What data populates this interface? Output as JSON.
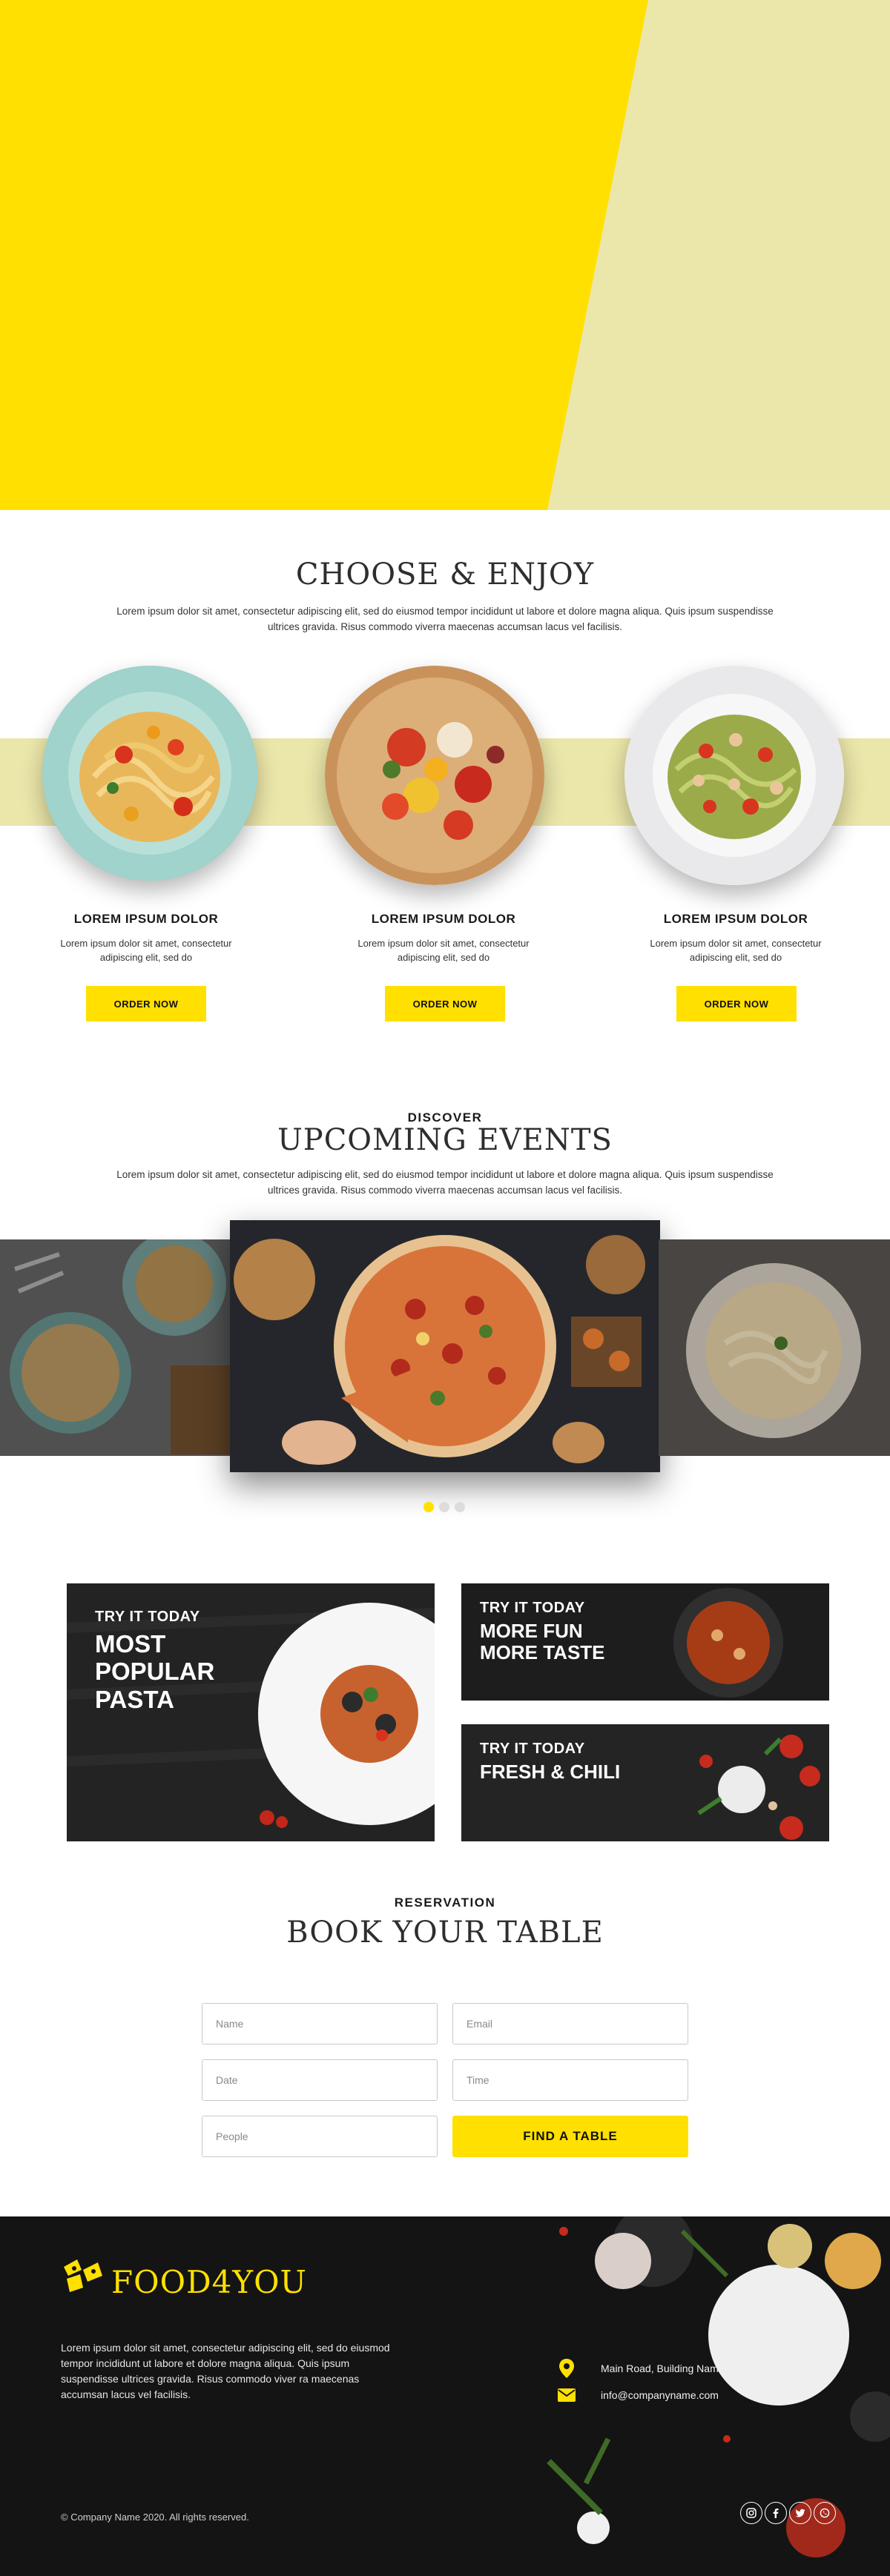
{
  "colors": {
    "accent": "#ffe000",
    "band": "#ebe6a9",
    "footer_bg": "#141414"
  },
  "choose": {
    "title": "Choose & Enjoy",
    "lead": "Lorem ipsum dolor sit amet, consectetur adipiscing elit, sed do eiusmod tempor incididunt ut labore et dolore magna aliqua. Quis ipsum suspendisse ultrices gravida. Risus commodo viverra maecenas accumsan lacus vel facilisis.",
    "dishes": [
      {
        "name": "LOREM IPSUM DOLOR",
        "desc": "Lorem ipsum dolor sit amet, consectetur adipiscing elit, sed do",
        "button": "ORDER NOW"
      },
      {
        "name": "LOREM IPSUM DOLOR",
        "desc": "Lorem ipsum dolor sit amet, consectetur adipiscing elit, sed do",
        "button": "ORDER NOW"
      },
      {
        "name": "LOREM IPSUM DOLOR",
        "desc": "Lorem ipsum dolor sit amet, consectetur adipiscing elit, sed do",
        "button": "ORDER NOW"
      }
    ]
  },
  "events": {
    "kicker": "DISCOVER",
    "title": "Upcoming Events",
    "lead": "Lorem ipsum dolor sit amet, consectetur adipiscing elit, sed do eiusmod tempor incididunt ut labore et dolore magna aliqua. Quis ipsum suspendisse ultrices gravida. Risus commodo viverra maecenas accumsan lacus vel facilisis.",
    "slide_count": 3,
    "active_slide": 1
  },
  "promos": [
    {
      "kicker": "TRY IT TODAY",
      "title": "MOST\nPOPULAR\nPASTA"
    },
    {
      "kicker": "TRY IT TODAY",
      "title": "MORE FUN\nMORE TASTE"
    },
    {
      "kicker": "TRY IT TODAY",
      "title": "FRESH & CHILI"
    }
  ],
  "reservation": {
    "kicker": "RESERVATION",
    "title": "Book Your Table",
    "fields": {
      "name": "Name",
      "email": "Email",
      "date": "Date",
      "time": "Time",
      "people": "People"
    },
    "button": "FIND A TABLE"
  },
  "footer": {
    "brand": "FOOD4YOU",
    "desc": "Lorem ipsum dolor sit amet, consectetur adipiscing elit, sed do eiusmod tempor incididunt ut labore et dolore magna aliqua. Quis ipsum suspendisse ultrices gravida. Risus commodo viver ra maecenas accumsan lacus vel facilisis.",
    "address": "Main Road, Building Name, Country",
    "email": "info@companyname.com",
    "copyright": "© Company Name 2020. All rights reserved.",
    "social": [
      "instagram-icon",
      "facebook-icon",
      "twitter-icon",
      "whatsapp-icon"
    ]
  }
}
